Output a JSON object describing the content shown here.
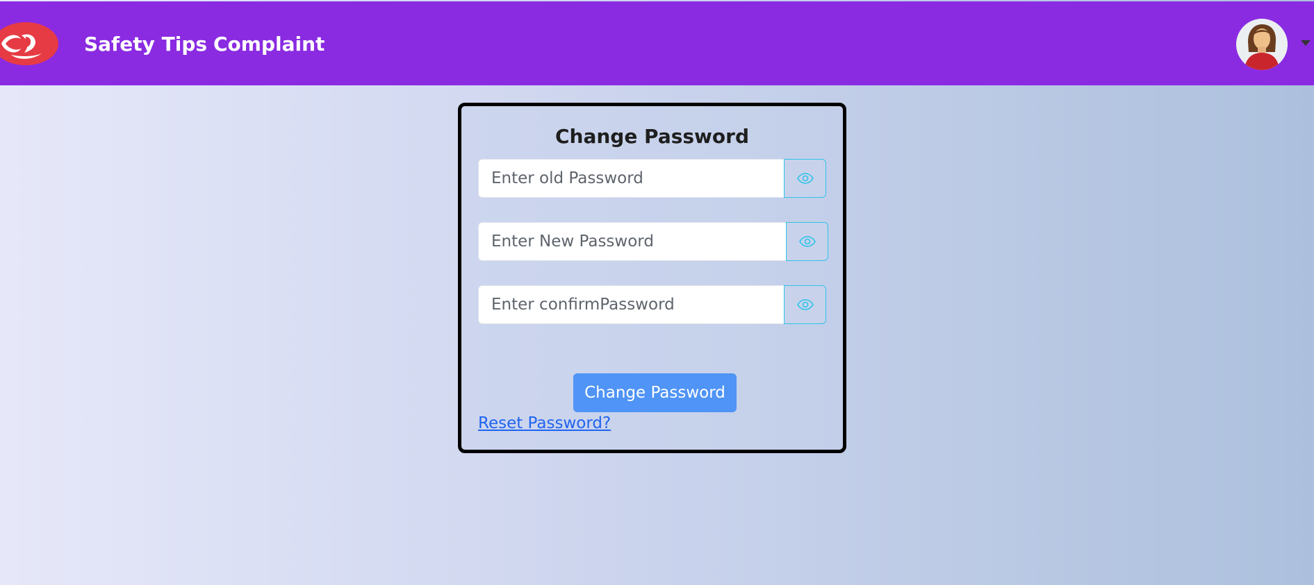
{
  "header": {
    "logo_icon": "shield-hand-logo",
    "nav_items": [
      {
        "label": "Safety Tips"
      },
      {
        "label": "Complaint"
      }
    ],
    "avatar_icon": "user-avatar",
    "menu_caret_icon": "chevron-down-icon"
  },
  "form": {
    "title": "Change Password",
    "fields": [
      {
        "placeholder": "Enter old Password",
        "value": "",
        "toggle_icon": "eye-icon"
      },
      {
        "placeholder": "Enter New Password",
        "value": "",
        "toggle_icon": "eye-icon"
      },
      {
        "placeholder": "Enter confirmPassword",
        "value": "",
        "toggle_icon": "eye-icon"
      }
    ],
    "submit_label": "Change Password",
    "reset_link_label": "Reset Password?"
  },
  "colors": {
    "navbar": "#8a2be2",
    "accent_button": "#4f94f6",
    "link": "#1f64f0",
    "input_toggle_border": "#2ec3ea",
    "logo": "#e63b44"
  }
}
